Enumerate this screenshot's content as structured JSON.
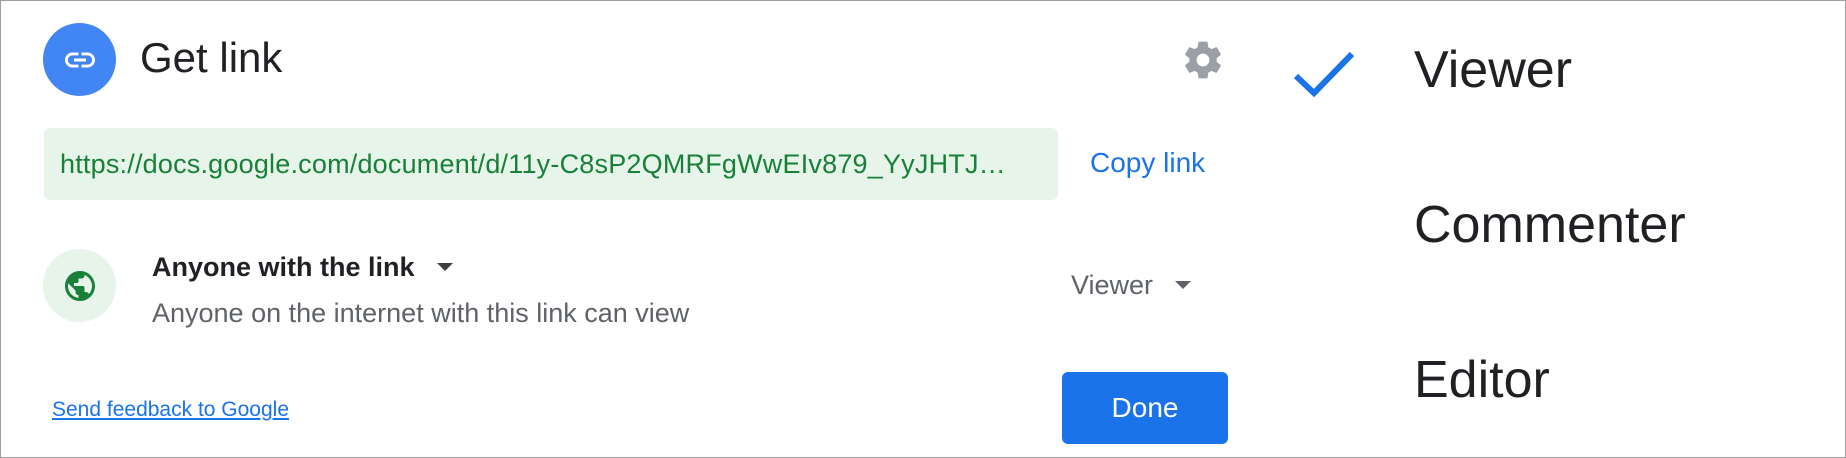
{
  "dialog": {
    "title": "Get link",
    "icons": {
      "header": "link-icon",
      "settings": "gear-icon",
      "access": "globe-icon"
    },
    "link": {
      "url": "https://docs.google.com/document/d/11y-C8sP2QMRFgWwEIv879_YyJHTJ…",
      "copy_label": "Copy link"
    },
    "access": {
      "title": "Anyone with the link",
      "description": "Anyone on the internet with this link can view",
      "role": "Viewer"
    },
    "footer": {
      "feedback_label": "Send feedback to Google",
      "done_label": "Done"
    }
  },
  "role_menu": {
    "selected": "Viewer",
    "items": [
      {
        "label": "Viewer",
        "checked": true
      },
      {
        "label": "Commenter",
        "checked": false
      },
      {
        "label": "Editor",
        "checked": false
      }
    ]
  },
  "colors": {
    "accent": "#1a73e8",
    "header_icon_bg": "#4285f4",
    "link_bg": "#e6f4ea",
    "link_text": "#188038"
  }
}
